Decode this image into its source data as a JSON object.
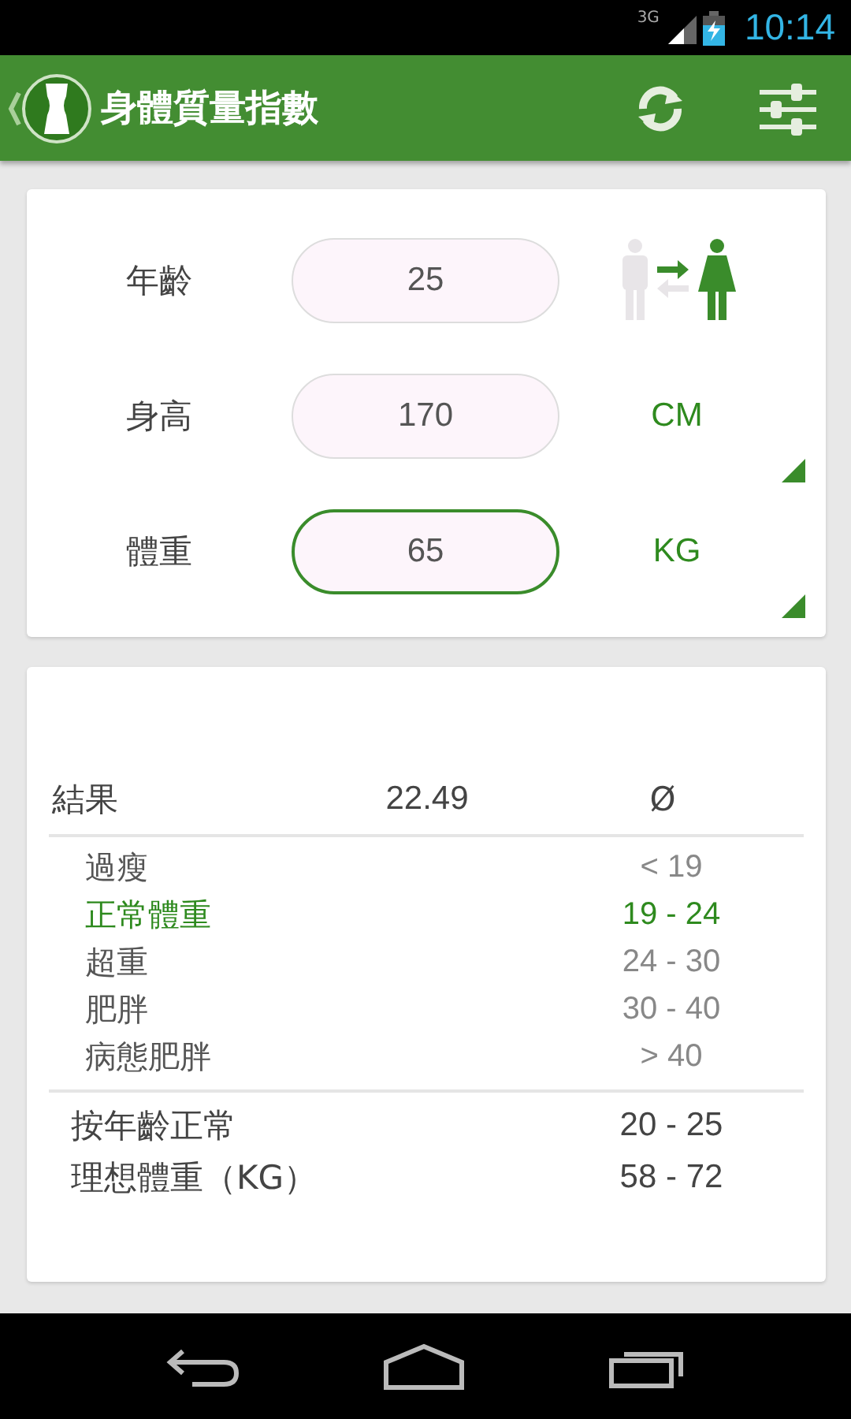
{
  "status_bar": {
    "network": "3G",
    "time": "10:14"
  },
  "app_bar": {
    "title": "身體質量指數"
  },
  "inputs": [
    {
      "label": "年齡",
      "value": "25",
      "focused": false,
      "kind": "gender"
    },
    {
      "label": "身高",
      "value": "170",
      "focused": false,
      "kind": "unit",
      "unit": "CM"
    },
    {
      "label": "體重",
      "value": "65",
      "focused": true,
      "kind": "unit",
      "unit": "KG"
    }
  ],
  "gender": {
    "female_selected": true
  },
  "result": {
    "label": "結果",
    "value": "22.49",
    "symbol": "Ø"
  },
  "categories": [
    {
      "label": "過瘦",
      "range": "< 19",
      "selected": false
    },
    {
      "label": "正常體重",
      "range": "19 - 24",
      "selected": true
    },
    {
      "label": "超重",
      "range": "24 - 30",
      "selected": false
    },
    {
      "label": "肥胖",
      "range": "30 - 40",
      "selected": false
    },
    {
      "label": "病態肥胖",
      "range": "> 40",
      "selected": false
    }
  ],
  "extras": [
    {
      "label": "按年齡正常",
      "value": "20 - 25"
    },
    {
      "label": "理想體重（KG）",
      "value": "58 - 72"
    }
  ]
}
